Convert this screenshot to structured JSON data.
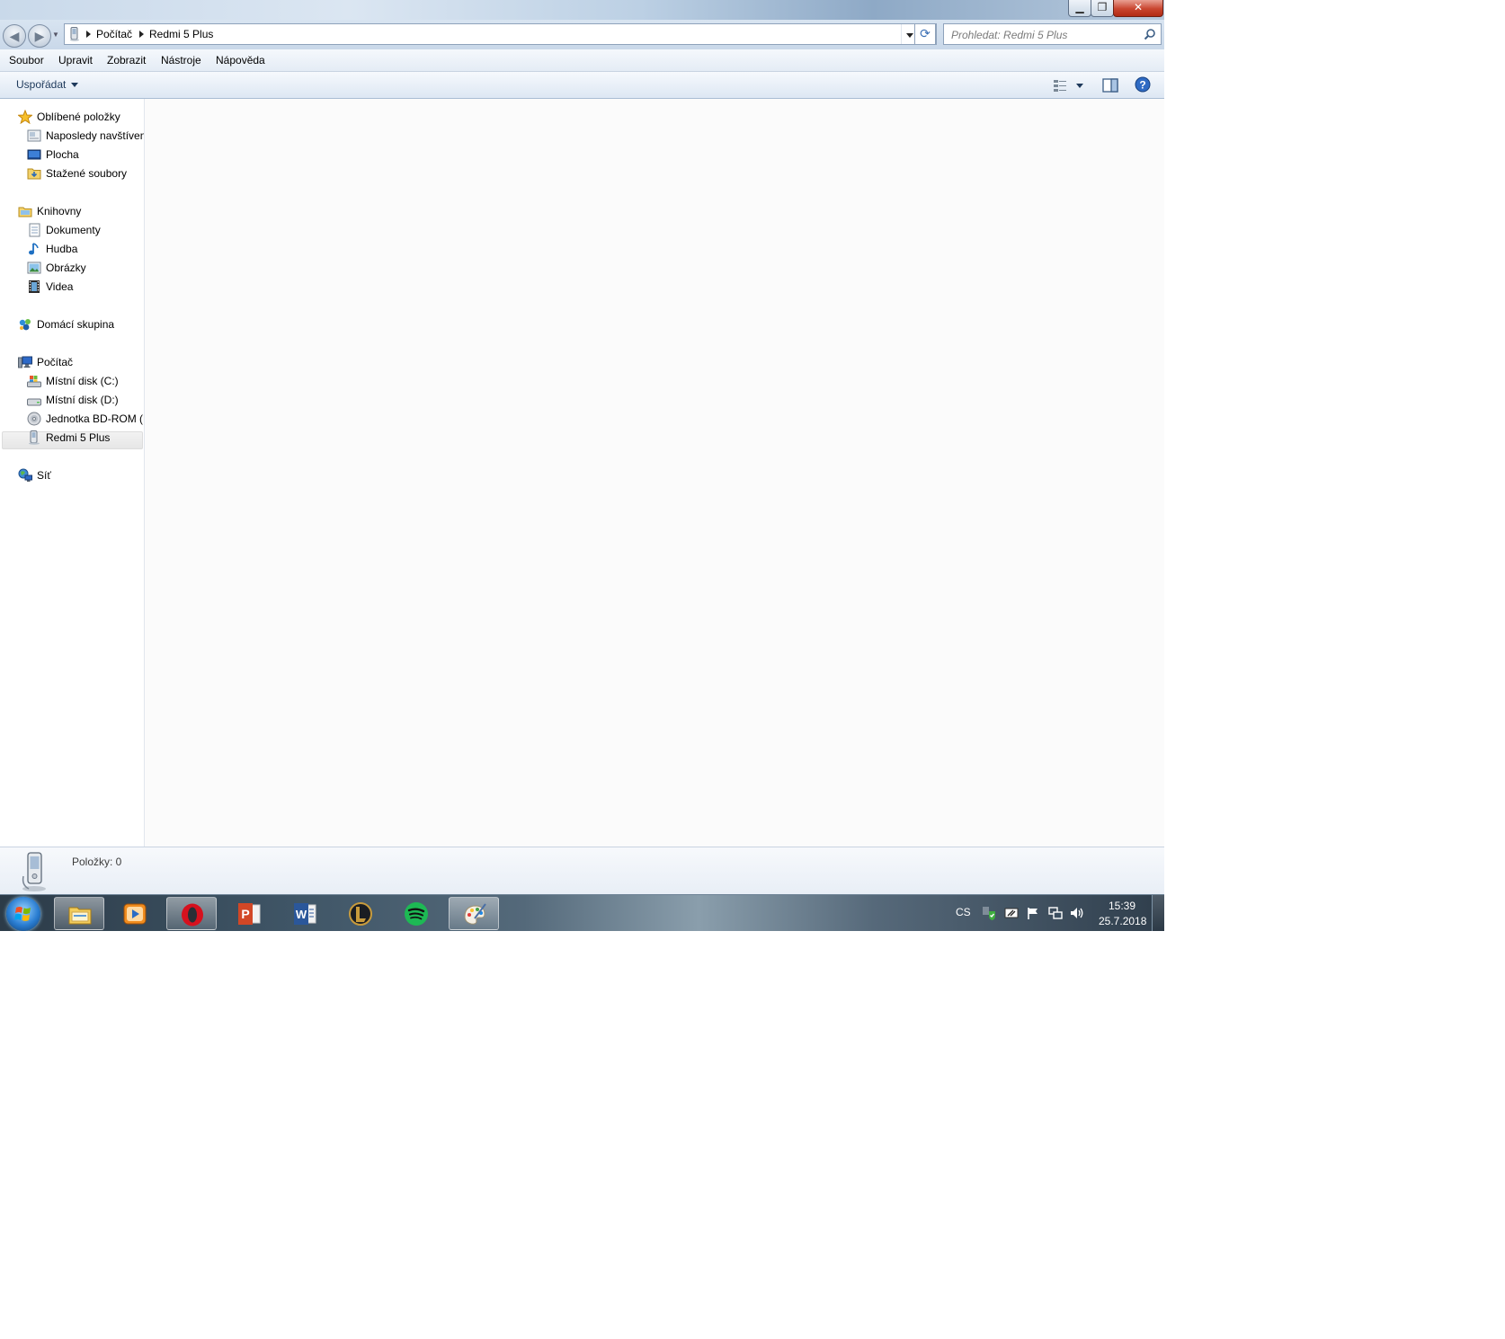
{
  "window": {
    "minimize_label": "▁",
    "maximize_label": "❐",
    "close_label": "✕"
  },
  "navigation": {
    "back_label": "◀",
    "forward_label": "▶",
    "breadcrumbs": [
      "Počítač",
      "Redmi 5 Plus"
    ],
    "refresh_label": "⟳",
    "search_placeholder": "Prohledat: Redmi 5 Plus"
  },
  "menu": {
    "items": [
      "Soubor",
      "Upravit",
      "Zobrazit",
      "Nástroje",
      "Nápověda"
    ]
  },
  "command_bar": {
    "organize_label": "Uspořádat"
  },
  "sidebar": {
    "favorites": {
      "label": "Oblíbené položky",
      "icon": "star-icon",
      "items": [
        {
          "label": "Naposledy navštívené",
          "icon": "recent-places-icon"
        },
        {
          "label": "Plocha",
          "icon": "desktop-icon"
        },
        {
          "label": "Stažené soubory",
          "icon": "downloads-folder-icon"
        }
      ]
    },
    "libraries": {
      "label": "Knihovny",
      "icon": "libraries-icon",
      "items": [
        {
          "label": "Dokumenty",
          "icon": "documents-icon"
        },
        {
          "label": "Hudba",
          "icon": "music-icon"
        },
        {
          "label": "Obrázky",
          "icon": "pictures-icon"
        },
        {
          "label": "Videa",
          "icon": "videos-icon"
        }
      ]
    },
    "homegroup": {
      "label": "Domácí skupina",
      "icon": "homegroup-icon"
    },
    "computer": {
      "label": "Počítač",
      "icon": "computer-icon",
      "items": [
        {
          "label": "Místní disk (C:)",
          "icon": "system-drive-icon"
        },
        {
          "label": "Místní disk (D:)",
          "icon": "drive-icon"
        },
        {
          "label": "Jednotka BD-ROM (E:)",
          "icon": "optical-drive-icon"
        },
        {
          "label": "Redmi 5 Plus",
          "icon": "portable-device-icon",
          "selected": true
        }
      ]
    },
    "network": {
      "label": "Síť",
      "icon": "network-icon"
    }
  },
  "details": {
    "items_count": "Položky: 0"
  },
  "taskbar": {
    "apps": [
      {
        "name": "Windows Explorer",
        "icon": "explorer-icon",
        "active": true
      },
      {
        "name": "Media Player",
        "icon": "media-player-icon",
        "active": false
      },
      {
        "name": "Opera",
        "icon": "opera-icon",
        "active": true
      },
      {
        "name": "PowerPoint",
        "icon": "powerpoint-icon",
        "active": false
      },
      {
        "name": "Word",
        "icon": "word-icon",
        "active": false
      },
      {
        "name": "League of Legends",
        "icon": "lol-icon",
        "active": false
      },
      {
        "name": "Spotify",
        "icon": "spotify-icon",
        "active": false
      },
      {
        "name": "Paint",
        "icon": "paint-icon",
        "active": true
      }
    ],
    "language": "CS",
    "clock_time": "15:39",
    "clock_date": "25.7.2018"
  }
}
